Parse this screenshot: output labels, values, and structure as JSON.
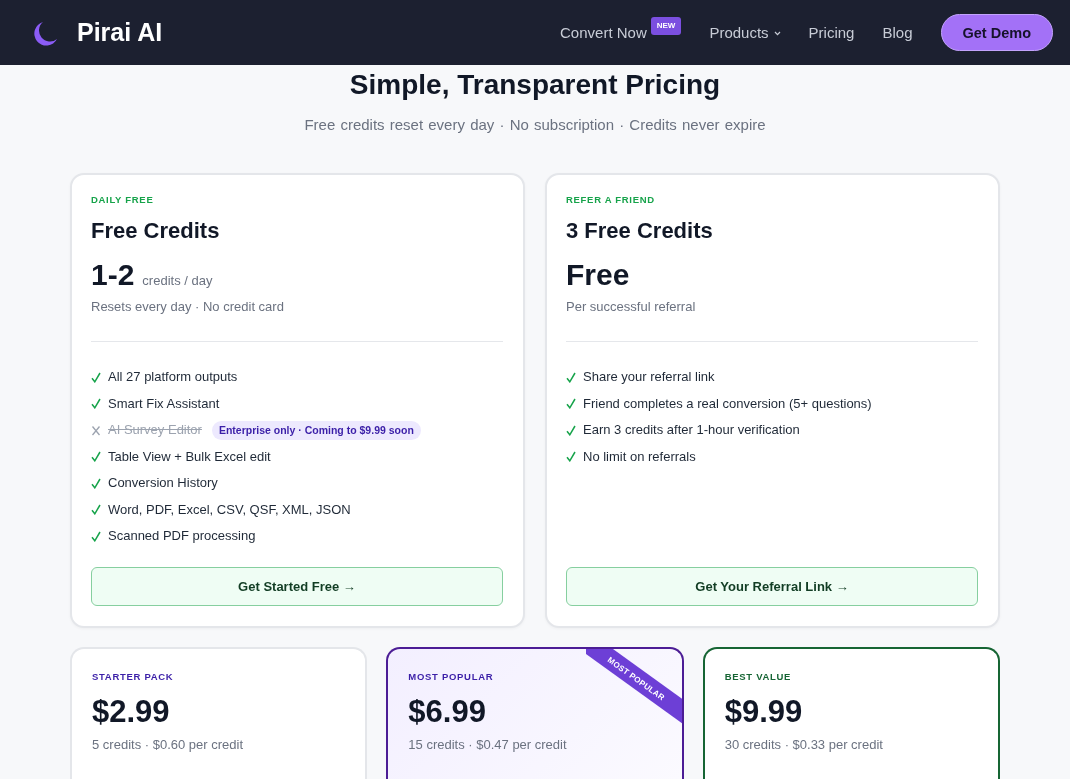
{
  "nav": {
    "brand": "Pirai AI",
    "links": [
      {
        "label": "Convert Now",
        "badge": "NEW",
        "dropdown": false
      },
      {
        "label": "Products",
        "dropdown": true
      },
      {
        "label": "Pricing",
        "dropdown": false
      },
      {
        "label": "Blog",
        "dropdown": false
      }
    ],
    "cta": "Get Demo"
  },
  "hero": {
    "title": "Simple, Transparent Pricing",
    "subtitle": "Free credits reset every day · No subscription · Credits never expire"
  },
  "free_plans": [
    {
      "eyebrow": "DAILY FREE",
      "title": "Free Credits",
      "price": "1-2",
      "unit": "credits / day",
      "note": "Resets every day · No credit card",
      "features": [
        {
          "text": "All 27 platform outputs",
          "included": true
        },
        {
          "text": "Smart Fix Assistant",
          "included": true
        },
        {
          "text": "AI Survey Editor",
          "included": false,
          "badge": "Enterprise only · Coming to $9.99 soon"
        },
        {
          "text": "Table View + Bulk Excel edit",
          "included": true
        },
        {
          "text": "Conversion History",
          "included": true
        },
        {
          "text": "Word, PDF, Excel, CSV, QSF, XML, JSON",
          "included": true
        },
        {
          "text": "Scanned PDF processing",
          "included": true
        }
      ],
      "button": "Get Started Free →"
    },
    {
      "eyebrow": "REFER A FRIEND",
      "title": "3 Free Credits",
      "price": "Free",
      "note": "Per successful referral",
      "features": [
        {
          "text": "Share your referral link",
          "included": true
        },
        {
          "text": "Friend completes a real conversion (5+ questions)",
          "included": true
        },
        {
          "text": "Earn 3 credits after 1-hour verification",
          "included": true
        },
        {
          "text": "No limit on referrals",
          "included": true
        }
      ],
      "button": "Get Your Referral Link →"
    }
  ],
  "packs": [
    {
      "kind": "starter",
      "eyebrow": "STARTER PACK",
      "price": "$2.99",
      "note": "5 credits · $0.60 per credit"
    },
    {
      "kind": "popular",
      "eyebrow": "MOST POPULAR",
      "ribbon": "MOST POPULAR",
      "price": "$6.99",
      "note": "15 credits · $0.47 per credit"
    },
    {
      "kind": "value",
      "eyebrow": "BEST VALUE",
      "price": "$9.99",
      "note": "30 credits · $0.33 per credit"
    }
  ]
}
